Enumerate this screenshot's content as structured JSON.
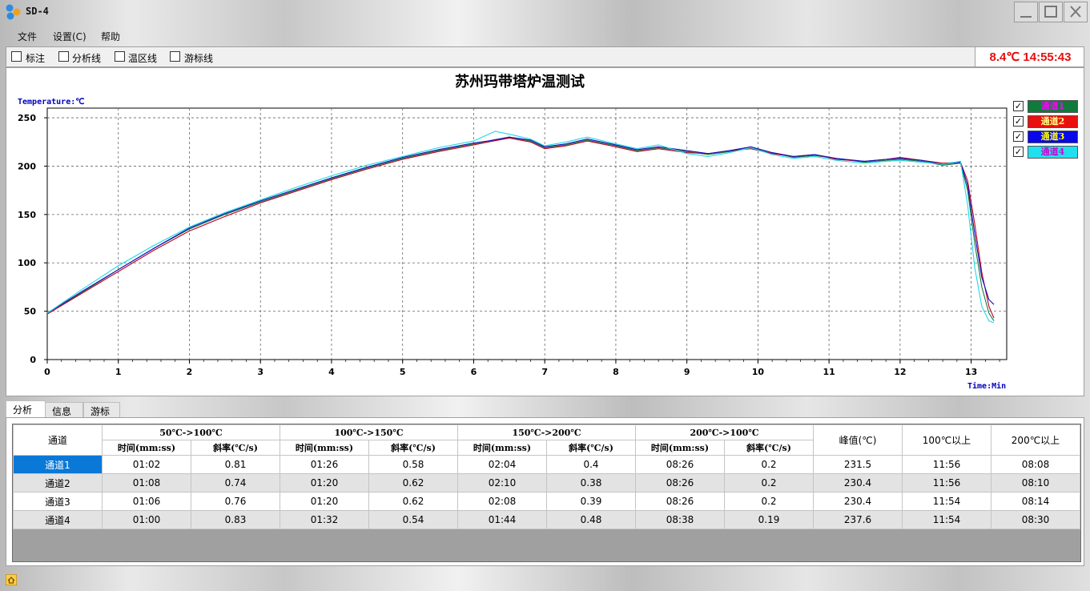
{
  "window": {
    "title": "SD-4"
  },
  "menu": [
    "文件",
    "设置(C)",
    "帮助"
  ],
  "toolbar": {
    "checkboxes": [
      {
        "label": "标注",
        "checked": false
      },
      {
        "label": "分析线",
        "checked": false
      },
      {
        "label": "温区线",
        "checked": false
      },
      {
        "label": "游标线",
        "checked": false
      }
    ],
    "status_clock": "8.4℃ 14:55:43"
  },
  "chart": {
    "title": "苏州玛带塔炉温测试",
    "ylabel": "Temperature:℃",
    "xlabel": "Time:Min",
    "legend": [
      {
        "label": "通道1",
        "checked": true
      },
      {
        "label": "通道2",
        "checked": true
      },
      {
        "label": "通道3",
        "checked": true
      },
      {
        "label": "通道4",
        "checked": true
      }
    ]
  },
  "colors": {
    "ch1": "#1a7a40",
    "ch2": "#c00020",
    "ch3": "#1010c0",
    "ch4": "#20d8e8",
    "legend1_bg": "#0f7a3a",
    "legend1_fg": "#ff00ff",
    "legend2_bg": "#e81010",
    "legend2_fg": "#ffff80",
    "legend3_bg": "#0808e8",
    "legend3_fg": "#ffff00",
    "legend4_bg": "#20e0f0",
    "legend4_fg": "#d000d0",
    "clock": "#e41010",
    "selected_row": "#0a78d7"
  },
  "chart_data": {
    "type": "line",
    "ylim": [
      0,
      260
    ],
    "xlim": [
      0,
      13.5
    ],
    "yticks": [
      0,
      50,
      100,
      150,
      200,
      250
    ],
    "xticks": [
      0,
      1,
      2,
      3,
      4,
      5,
      6,
      7,
      8,
      9,
      10,
      11,
      12,
      13
    ],
    "grid": true,
    "legend_position": "right",
    "series": [
      {
        "name": "通道1",
        "color": "#1a7a40",
        "x": [
          0,
          0.5,
          1,
          1.5,
          2,
          2.5,
          3,
          3.5,
          4,
          4.5,
          5,
          5.5,
          6,
          6.2,
          6.5,
          6.8,
          7,
          7.3,
          7.6,
          8,
          8.3,
          8.6,
          9,
          9.3,
          9.6,
          9.9,
          10.2,
          10.5,
          10.8,
          11.1,
          11.5,
          11.8,
          12,
          12.3,
          12.6,
          12.85,
          12.95,
          13.05,
          13.15,
          13.25,
          13.32
        ],
        "y": [
          47,
          70,
          93,
          115,
          135,
          150,
          163,
          175,
          187,
          198,
          208,
          216,
          223,
          225,
          230,
          226,
          219,
          222,
          227,
          221,
          216,
          219,
          215,
          212,
          215,
          219,
          214,
          209,
          211,
          208,
          204,
          206,
          207,
          205,
          201,
          203,
          175,
          120,
          75,
          48,
          40
        ]
      },
      {
        "name": "通道2",
        "color": "#c00020",
        "x": [
          0,
          0.5,
          1,
          1.5,
          2,
          2.5,
          3,
          3.5,
          4,
          4.5,
          5,
          5.5,
          6,
          6.2,
          6.5,
          6.8,
          7,
          7.3,
          7.6,
          8,
          8.3,
          8.6,
          9,
          9.3,
          9.6,
          9.9,
          10.2,
          10.5,
          10.8,
          11.1,
          11.5,
          11.8,
          12,
          12.3,
          12.6,
          12.85,
          12.95,
          13.05,
          13.15,
          13.25,
          13.32
        ],
        "y": [
          47,
          69,
          91,
          113,
          133,
          148,
          162,
          174,
          186,
          197,
          207,
          215,
          222,
          225,
          229,
          225,
          218,
          221,
          226,
          220,
          215,
          218,
          214,
          213,
          216,
          218,
          213,
          210,
          212,
          207,
          205,
          207,
          209,
          206,
          203,
          204,
          185,
          140,
          90,
          55,
          43
        ]
      },
      {
        "name": "通道3",
        "color": "#1010c0",
        "x": [
          0,
          0.5,
          1,
          1.5,
          2,
          2.5,
          3,
          3.5,
          4,
          4.5,
          5,
          5.5,
          6,
          6.2,
          6.5,
          6.8,
          7,
          7.3,
          7.6,
          8,
          8.3,
          8.6,
          9,
          9.3,
          9.6,
          9.9,
          10.2,
          10.5,
          10.8,
          11.1,
          11.5,
          11.8,
          12,
          12.3,
          12.6,
          12.85,
          12.95,
          13.05,
          13.15,
          13.25,
          13.32
        ],
        "y": [
          48,
          71,
          93,
          115,
          136,
          151,
          164,
          176,
          188,
          199,
          209,
          217,
          224,
          226,
          230,
          227,
          220,
          223,
          228,
          222,
          217,
          220,
          216,
          213,
          216,
          220,
          214,
          210,
          212,
          208,
          205,
          207,
          208,
          206,
          202,
          204,
          180,
          130,
          85,
          62,
          57
        ]
      },
      {
        "name": "通道4",
        "color": "#20d8e8",
        "x": [
          0,
          0.5,
          1,
          1.5,
          2,
          2.5,
          3,
          3.5,
          4,
          4.5,
          5,
          5.5,
          6,
          6.3,
          6.5,
          6.8,
          7,
          7.3,
          7.6,
          8,
          8.3,
          8.6,
          9,
          9.3,
          9.6,
          9.9,
          10.2,
          10.5,
          10.8,
          11.1,
          11.5,
          11.8,
          12,
          12.3,
          12.6,
          12.85,
          12.95,
          13.05,
          13.15,
          13.25,
          13.32
        ],
        "y": [
          48,
          73,
          97,
          118,
          137,
          152,
          165,
          178,
          190,
          201,
          210,
          219,
          226,
          236,
          233,
          228,
          221,
          225,
          230,
          223,
          218,
          222,
          213,
          210,
          214,
          219,
          212,
          208,
          210,
          206,
          203,
          205,
          206,
          204,
          202,
          205,
          160,
          95,
          55,
          40,
          38
        ]
      }
    ]
  },
  "tabs": [
    "分析",
    "信息",
    "游标"
  ],
  "table": {
    "channel_header": "通道",
    "groups": [
      "50℃->100℃",
      "100℃->150℃",
      "150℃->200℃",
      "200℃->100℃"
    ],
    "sub_time": "时间(mm:ss)",
    "sub_slope": "斜率(℃/s)",
    "peak_header": "峰值(℃)",
    "above100_header": "100℃以上",
    "above200_header": "200℃以上",
    "rows": [
      {
        "channel": "通道1",
        "t1": "01:02",
        "s1": "0.81",
        "t2": "01:26",
        "s2": "0.58",
        "t3": "02:04",
        "s3": "0.4",
        "t4": "08:26",
        "s4": "0.2",
        "peak": "231.5",
        "above100": "11:56",
        "above200": "08:08"
      },
      {
        "channel": "通道2",
        "t1": "01:08",
        "s1": "0.74",
        "t2": "01:20",
        "s2": "0.62",
        "t3": "02:10",
        "s3": "0.38",
        "t4": "08:26",
        "s4": "0.2",
        "peak": "230.4",
        "above100": "11:56",
        "above200": "08:10"
      },
      {
        "channel": "通道3",
        "t1": "01:06",
        "s1": "0.76",
        "t2": "01:20",
        "s2": "0.62",
        "t3": "02:08",
        "s3": "0.39",
        "t4": "08:26",
        "s4": "0.2",
        "peak": "230.4",
        "above100": "11:54",
        "above200": "08:14"
      },
      {
        "channel": "通道4",
        "t1": "01:00",
        "s1": "0.83",
        "t2": "01:32",
        "s2": "0.54",
        "t3": "01:44",
        "s3": "0.48",
        "t4": "08:38",
        "s4": "0.19",
        "peak": "237.6",
        "above100": "11:54",
        "above200": "08:30"
      }
    ]
  }
}
